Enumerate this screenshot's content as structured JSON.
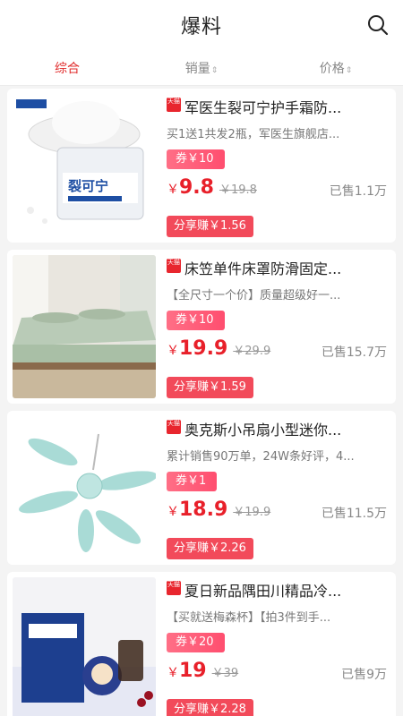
{
  "header": {
    "title": "爆料",
    "search_icon": "search-icon"
  },
  "tabs": [
    {
      "label": "综合",
      "active": true
    },
    {
      "label": "销量",
      "sort_icon": "sort-arrows-icon"
    },
    {
      "label": "价格",
      "sort_icon": "sort-arrows-icon"
    }
  ],
  "colors": {
    "accent": "#e02b2b",
    "coupon": "#ff4e6f",
    "share": "#f24a5a"
  },
  "products": [
    {
      "badge": "天猫",
      "name": "军医生裂可宁护手霜防...",
      "desc": "买1送1共发2瓶，军医生旗舰店...",
      "coupon_label": "券",
      "coupon_amount": "￥10",
      "currency": "￥",
      "price": "9.8",
      "original_price": "￥19.8",
      "sold": "已售1.1万",
      "share": "分享赚￥1.56",
      "image": "hand-cream-jar"
    },
    {
      "badge": "天猫",
      "name": "床笠单件床罩防滑固定...",
      "desc": "【全尺寸一个价】质量超级好一...",
      "coupon_label": "券",
      "coupon_amount": "￥10",
      "currency": "￥",
      "price": "19.9",
      "original_price": "￥29.9",
      "sold": "已售15.7万",
      "share": "分享赚￥1.59",
      "image": "bed-sheet"
    },
    {
      "badge": "天猫",
      "name": "奥克斯小吊扇小型迷你...",
      "desc": "累计销售90万单，24W条好评，4...",
      "coupon_label": "券",
      "coupon_amount": "￥1",
      "currency": "￥",
      "price": "18.9",
      "original_price": "￥19.9",
      "sold": "已售11.5万",
      "share": "分享赚￥2.26",
      "image": "ceiling-fan"
    },
    {
      "badge": "天猫",
      "name": "夏日新品隅田川精品冷...",
      "desc": "【买就送梅森杯】【拍3件到手...",
      "coupon_label": "券",
      "coupon_amount": "￥20",
      "currency": "￥",
      "price": "19",
      "original_price": "￥39",
      "sold": "已售9万",
      "share": "分享赚￥2.28",
      "image": "cold-brew-coffee"
    }
  ]
}
